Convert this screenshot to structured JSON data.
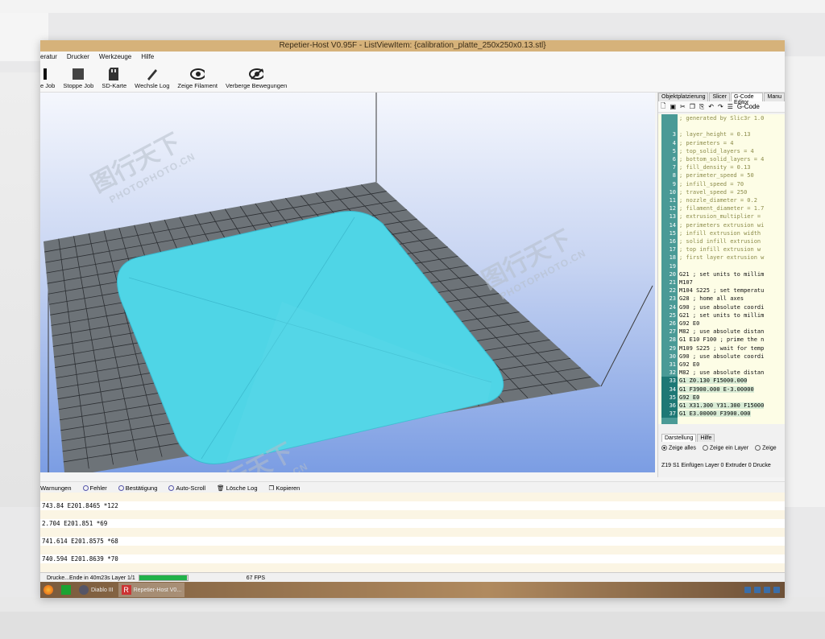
{
  "window": {
    "title": "Repetier-Host V0.95F - ListViewItem: {calibration_platte_250x250x0.13.stl}"
  },
  "menu": [
    "eratur",
    "Drucker",
    "Werkzeuge",
    "Hilfe"
  ],
  "toolbar": [
    {
      "label": "e Job",
      "icon": "stop-icon"
    },
    {
      "label": "Stoppe Job",
      "icon": "stop-square-icon"
    },
    {
      "label": "SD-Karte",
      "icon": "sd-card-icon"
    },
    {
      "label": "Wechsle Log",
      "icon": "pencil-icon"
    },
    {
      "label": "Zeige Filament",
      "icon": "eye-icon"
    },
    {
      "label": "Verberge Bewegungen",
      "icon": "eye-hidden-icon"
    }
  ],
  "watermarks": [
    {
      "cn": "图行天下",
      "en": "PHOTOPHOTO.CN"
    },
    {
      "cn": "图行天下",
      "en": "PHOTOPHOTO.CN"
    },
    {
      "cn": "图行天下",
      "en": "PHOTOPHOTO.CN"
    }
  ],
  "right_panel": {
    "tabs": [
      "Objektplatzierung",
      "Slicer",
      "G-Code Editor",
      "Manu"
    ],
    "active_tab": "G-Code Editor",
    "editor_mode": "G-Code",
    "code_lines": [
      {
        "n": "",
        "t": "; generated by Slic3r 1.0",
        "kind": "comment"
      },
      {
        "n": "",
        "t": "",
        "kind": "comment"
      },
      {
        "n": "3",
        "t": "; layer_height = 0.13",
        "kind": "comment"
      },
      {
        "n": "4",
        "t": "; perimeters = 4",
        "kind": "comment"
      },
      {
        "n": "5",
        "t": "; top_solid_layers = 4",
        "kind": "comment"
      },
      {
        "n": "6",
        "t": "; bottom_solid_layers = 4",
        "kind": "comment"
      },
      {
        "n": "7",
        "t": "; fill_density = 0.13",
        "kind": "comment"
      },
      {
        "n": "8",
        "t": "; perimeter_speed = 50",
        "kind": "comment"
      },
      {
        "n": "9",
        "t": "; infill_speed = 70",
        "kind": "comment"
      },
      {
        "n": "10",
        "t": "; travel_speed = 250",
        "kind": "comment"
      },
      {
        "n": "11",
        "t": "; nozzle_diameter = 0.2",
        "kind": "comment"
      },
      {
        "n": "12",
        "t": "; filament_diameter = 1.7",
        "kind": "comment"
      },
      {
        "n": "13",
        "t": "; extrusion_multiplier =",
        "kind": "comment"
      },
      {
        "n": "14",
        "t": "; perimeters extrusion wi",
        "kind": "comment"
      },
      {
        "n": "15",
        "t": "; infill extrusion width",
        "kind": "comment"
      },
      {
        "n": "16",
        "t": "; solid infill extrusion",
        "kind": "comment"
      },
      {
        "n": "17",
        "t": "; top infill extrusion w",
        "kind": "comment"
      },
      {
        "n": "18",
        "t": "; first layer extrusion w",
        "kind": "comment"
      },
      {
        "n": "19",
        "t": "",
        "kind": "comment"
      },
      {
        "n": "20",
        "t": "G21 ; set units to millim",
        "kind": "cmd"
      },
      {
        "n": "21",
        "t": "M107",
        "kind": "cmd"
      },
      {
        "n": "22",
        "t": "M104 S225 ; set temperatu",
        "kind": "cmd"
      },
      {
        "n": "23",
        "t": "G28 ; home all axes",
        "kind": "cmd"
      },
      {
        "n": "24",
        "t": "G90 ; use absolute coordi",
        "kind": "cmd"
      },
      {
        "n": "25",
        "t": "G21 ; set units to millim",
        "kind": "cmd"
      },
      {
        "n": "26",
        "t": "G92 E0",
        "kind": "cmd"
      },
      {
        "n": "27",
        "t": "M82 ; use absolute distan",
        "kind": "cmd"
      },
      {
        "n": "28",
        "t": "G1 E10 F100 ; prime the n",
        "kind": "cmd"
      },
      {
        "n": "29",
        "t": "M109 S225 ; wait for temp",
        "kind": "cmd"
      },
      {
        "n": "30",
        "t": "G90 ; use absolute coordi",
        "kind": "cmd"
      },
      {
        "n": "31",
        "t": "G92 E0",
        "kind": "cmd"
      },
      {
        "n": "32",
        "t": "M82 ; use absolute distan",
        "kind": "cmd"
      },
      {
        "n": "33",
        "t": "G1 Z0.130 F15000.000",
        "kind": "hl"
      },
      {
        "n": "34",
        "t": "G1 F3900.000 E-3.00000",
        "kind": "hl"
      },
      {
        "n": "35",
        "t": "G92 E0",
        "kind": "hl"
      },
      {
        "n": "36",
        "t": "G1 X31.300 Y31.300 F15000",
        "kind": "hl"
      },
      {
        "n": "37",
        "t": "G1 E3.00000 F3900.000",
        "kind": "hl"
      }
    ],
    "bottom_tabs": [
      "Darstellung",
      "Hilfe"
    ],
    "radios": [
      {
        "label": "Zeige alles",
        "on": true
      },
      {
        "label": "Zeige ein Layer",
        "on": false
      },
      {
        "label": "Zeige",
        "on": false
      }
    ],
    "status": "Z19  S1  Einfügen  Layer 0  Extruder 0  Drucke"
  },
  "log_toolbar": [
    {
      "label": "Warnungen",
      "kind": "plain"
    },
    {
      "label": "Fehler",
      "kind": "radio"
    },
    {
      "label": "Bestätigung",
      "kind": "radio"
    },
    {
      "label": "Auto-Scroll",
      "kind": "radio"
    },
    {
      "label": "Lösche Log",
      "kind": "icon"
    },
    {
      "label": "Kopieren",
      "kind": "icon"
    }
  ],
  "log_lines": [
    "",
    "743.84 E201.8465 *122",
    "",
    "2.704 E201.851 *69",
    "",
    "741.614 E201.8575 *68",
    "",
    "740.594 E201.8639 *70",
    ""
  ],
  "status_bar": {
    "text": "Drucke...Ende in 40m23s Layer 1/1",
    "progress": 0.98,
    "fps": "67 FPS"
  },
  "taskbar": [
    {
      "label": "",
      "icon": "firefox-icon",
      "active": false
    },
    {
      "label": "",
      "icon": "store-icon",
      "active": false
    },
    {
      "label": "Diablo III",
      "icon": "diablo-icon",
      "active": false
    },
    {
      "label": "Repetier-Host V0...",
      "icon": "repetier-icon",
      "active": true
    }
  ],
  "colors": {
    "titlebar": "#d6b27a",
    "object": "#4fd5e6",
    "bed": "#6d7378",
    "gutter": "#4a9a96",
    "progress": "#21b24a"
  }
}
